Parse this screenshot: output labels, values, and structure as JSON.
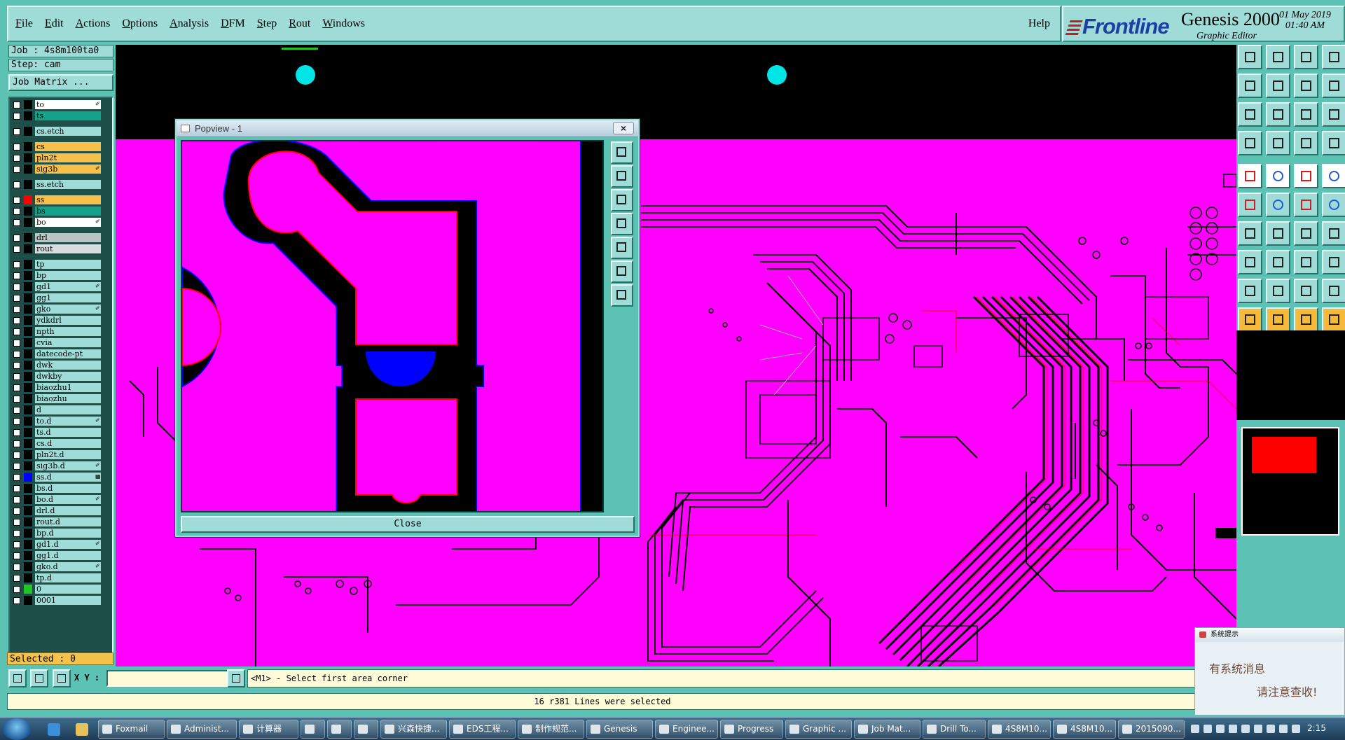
{
  "menu": {
    "items": [
      "File",
      "Edit",
      "Actions",
      "Options",
      "Analysis",
      "DFM",
      "Step",
      "Rout",
      "Windows"
    ],
    "help": "Help"
  },
  "brand": {
    "logo": "Frontline",
    "product": "Genesis 2000",
    "subtitle": "Graphic Editor",
    "date": "01 May 2019",
    "time": "01:40 AM"
  },
  "job": {
    "job_label": "Job : 4s8m100ta0",
    "step_label": "Step: cam",
    "matrix_button": "Job Matrix ...",
    "selected": "Selected : 0"
  },
  "layers": [
    {
      "name": "to",
      "color": "#ffffff",
      "swatch": "#000000",
      "mark": "✐"
    },
    {
      "name": "ts",
      "color": "#14a38a",
      "swatch": "#000000",
      "mark": ""
    },
    {
      "name": "cs.etch",
      "color": "#9fdcd8",
      "swatch": "#000000",
      "mark": "",
      "gap": true
    },
    {
      "name": "cs",
      "color": "#f6c04a",
      "swatch": "#000000",
      "mark": "",
      "gap": true
    },
    {
      "name": "pln2t",
      "color": "#f6c04a",
      "swatch": "#000000",
      "mark": ""
    },
    {
      "name": "sig3b",
      "color": "#f6c04a",
      "swatch": "#000000",
      "mark": "✐"
    },
    {
      "name": "ss.etch",
      "color": "#9fdcd8",
      "swatch": "#000000",
      "mark": "",
      "gap": true
    },
    {
      "name": "ss",
      "color": "#f6c04a",
      "swatch": "#ff0000",
      "mark": "",
      "gap": true
    },
    {
      "name": "bs",
      "color": "#14a38a",
      "swatch": "#000000",
      "mark": ""
    },
    {
      "name": "bo",
      "color": "#ffffff",
      "swatch": "#000000",
      "mark": "✐"
    },
    {
      "name": "drl",
      "color": "#b9c4c4",
      "swatch": "#000000",
      "mark": "",
      "gap": true
    },
    {
      "name": "rout",
      "color": "#d8dcdc",
      "swatch": "#000000",
      "mark": ""
    },
    {
      "name": "tp",
      "color": "#9fdcd8",
      "swatch": "#000000",
      "mark": "",
      "gap": true
    },
    {
      "name": "bp",
      "color": "#9fdcd8",
      "swatch": "#000000",
      "mark": ""
    },
    {
      "name": "gd1",
      "color": "#9fdcd8",
      "swatch": "#000000",
      "mark": "✐"
    },
    {
      "name": "gg1",
      "color": "#9fdcd8",
      "swatch": "#000000",
      "mark": ""
    },
    {
      "name": "gko",
      "color": "#9fdcd8",
      "swatch": "#000000",
      "mark": "✐"
    },
    {
      "name": "ydkdrl",
      "color": "#9fdcd8",
      "swatch": "#000000",
      "mark": ""
    },
    {
      "name": "npth",
      "color": "#9fdcd8",
      "swatch": "#000000",
      "mark": ""
    },
    {
      "name": "cvia",
      "color": "#9fdcd8",
      "swatch": "#000000",
      "mark": ""
    },
    {
      "name": "datecode-pt",
      "color": "#9fdcd8",
      "swatch": "#000000",
      "mark": ""
    },
    {
      "name": "dwk",
      "color": "#9fdcd8",
      "swatch": "#000000",
      "mark": ""
    },
    {
      "name": "dwkby",
      "color": "#9fdcd8",
      "swatch": "#000000",
      "mark": ""
    },
    {
      "name": "biaozhu1",
      "color": "#9fdcd8",
      "swatch": "#000000",
      "mark": ""
    },
    {
      "name": "biaozhu",
      "color": "#9fdcd8",
      "swatch": "#000000",
      "mark": ""
    },
    {
      "name": "d",
      "color": "#9fdcd8",
      "swatch": "#000000",
      "mark": ""
    },
    {
      "name": "to.d",
      "color": "#9fdcd8",
      "swatch": "#000000",
      "mark": "✐"
    },
    {
      "name": "ts.d",
      "color": "#9fdcd8",
      "swatch": "#000000",
      "mark": ""
    },
    {
      "name": "cs.d",
      "color": "#9fdcd8",
      "swatch": "#000000",
      "mark": ""
    },
    {
      "name": "pln2t.d",
      "color": "#9fdcd8",
      "swatch": "#000000",
      "mark": ""
    },
    {
      "name": "sig3b.d",
      "color": "#9fdcd8",
      "swatch": "#000000",
      "mark": "✐"
    },
    {
      "name": "ss.d",
      "color": "#9fdcd8",
      "swatch": "#0000ff",
      "mark": "▦"
    },
    {
      "name": "bs.d",
      "color": "#9fdcd8",
      "swatch": "#000000",
      "mark": ""
    },
    {
      "name": "bo.d",
      "color": "#9fdcd8",
      "swatch": "#000000",
      "mark": "✐"
    },
    {
      "name": "drl.d",
      "color": "#9fdcd8",
      "swatch": "#000000",
      "mark": ""
    },
    {
      "name": "rout.d",
      "color": "#9fdcd8",
      "swatch": "#000000",
      "mark": ""
    },
    {
      "name": "bp.d",
      "color": "#9fdcd8",
      "swatch": "#000000",
      "mark": ""
    },
    {
      "name": "gd1.d",
      "color": "#9fdcd8",
      "swatch": "#000000",
      "mark": "✐"
    },
    {
      "name": "gg1.d",
      "color": "#9fdcd8",
      "swatch": "#000000",
      "mark": ""
    },
    {
      "name": "gko.d",
      "color": "#9fdcd8",
      "swatch": "#000000",
      "mark": "✐"
    },
    {
      "name": "tp.d",
      "color": "#9fdcd8",
      "swatch": "#000000",
      "mark": ""
    },
    {
      "name": "0",
      "color": "#9fdcd8",
      "swatch": "#22c422",
      "mark": ""
    },
    {
      "name": "0001",
      "color": "#9fdcd8",
      "swatch": "#000000",
      "mark": ""
    }
  ],
  "popview": {
    "title": "Popview - 1",
    "close_x": "×",
    "close_button": "Close"
  },
  "command": {
    "xy_label": "X Y :",
    "xy_value": "",
    "prompt": "<M1> - Select first area corner",
    "status": "16 r381 Lines were selected"
  },
  "notify": {
    "title": "系统提示",
    "line1": "有系统消息",
    "line2": "请注意查收!"
  },
  "taskbar": {
    "tasks": [
      "Foxmail",
      "Administ...",
      "计算器",
      "",
      "",
      "",
      "兴森快捷...",
      "EDS工程...",
      "制作规范...",
      "Genesis",
      "Enginee...",
      "Progress",
      "Graphic ...",
      "Job Mat...",
      "Drill To...",
      "4S8M10...",
      "4S8M10...",
      "2015090..."
    ],
    "clock": "2:15"
  },
  "colors": {
    "panel": "#5cc3b4",
    "panel_light": "#9fdcd8",
    "board": "#ff00ff",
    "trace": "#000000",
    "trace_edge": "#ff0000",
    "pad_blue": "#0000ff",
    "fiducial": "#00e5e5"
  }
}
